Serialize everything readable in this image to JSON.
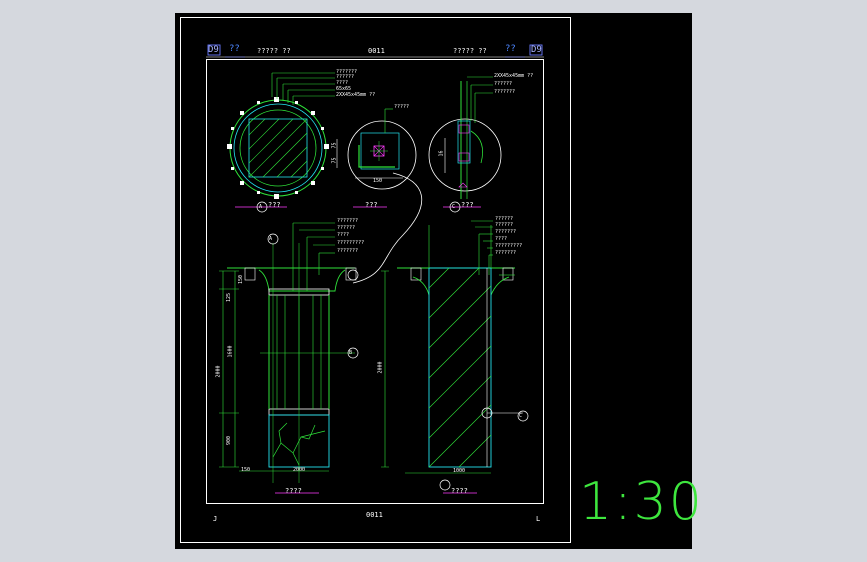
{
  "drawing": {
    "header": {
      "left_code": "D9",
      "left_marks": "??",
      "left_title": "?????  ??",
      "center_code": "0011",
      "right_title": "?????  ??",
      "right_marks": "??",
      "right_code": "D9"
    },
    "footer": {
      "left_mark": "J",
      "center_code": "0011",
      "right_mark": "L"
    },
    "plan_labels": {
      "left": "???",
      "middle": "???",
      "right": "???"
    },
    "plan_bubbles": {
      "left": "A",
      "right": "C"
    },
    "circle_leaders": [
      "???????",
      "??????",
      "????",
      "65x65",
      "2XX45x45mm ??"
    ],
    "detail_leader": "?????",
    "detail_dims": [
      "150",
      "75",
      "75"
    ],
    "right_leaders": [
      "2XX45x45mm ??",
      "??????",
      "???????"
    ],
    "right_dim": "16",
    "elev_left_leaders": [
      "???????",
      "??????",
      "????",
      "?????????",
      "???????"
    ],
    "elev_right_leaders": [
      "??????",
      "??????",
      "???????",
      "????",
      "?????????",
      "???????"
    ],
    "elev_left_dims": [
      "150",
      "125",
      "2000",
      "1600",
      "900",
      "150",
      "2000"
    ],
    "elev_right_dims": [
      "2000",
      "1000"
    ],
    "elev_titles": {
      "left": "????",
      "right": "????"
    },
    "elev_bubbles": [
      "A",
      "B",
      "C"
    ],
    "scale": "1:30"
  },
  "colors": {
    "background": "#d5d8de",
    "canvas": "#000000",
    "frame": "#ffffff",
    "green": "#2fe23a",
    "cyan": "#23e4ee",
    "magenta": "#ff3cff",
    "blue_icon": "#6a7bff"
  }
}
